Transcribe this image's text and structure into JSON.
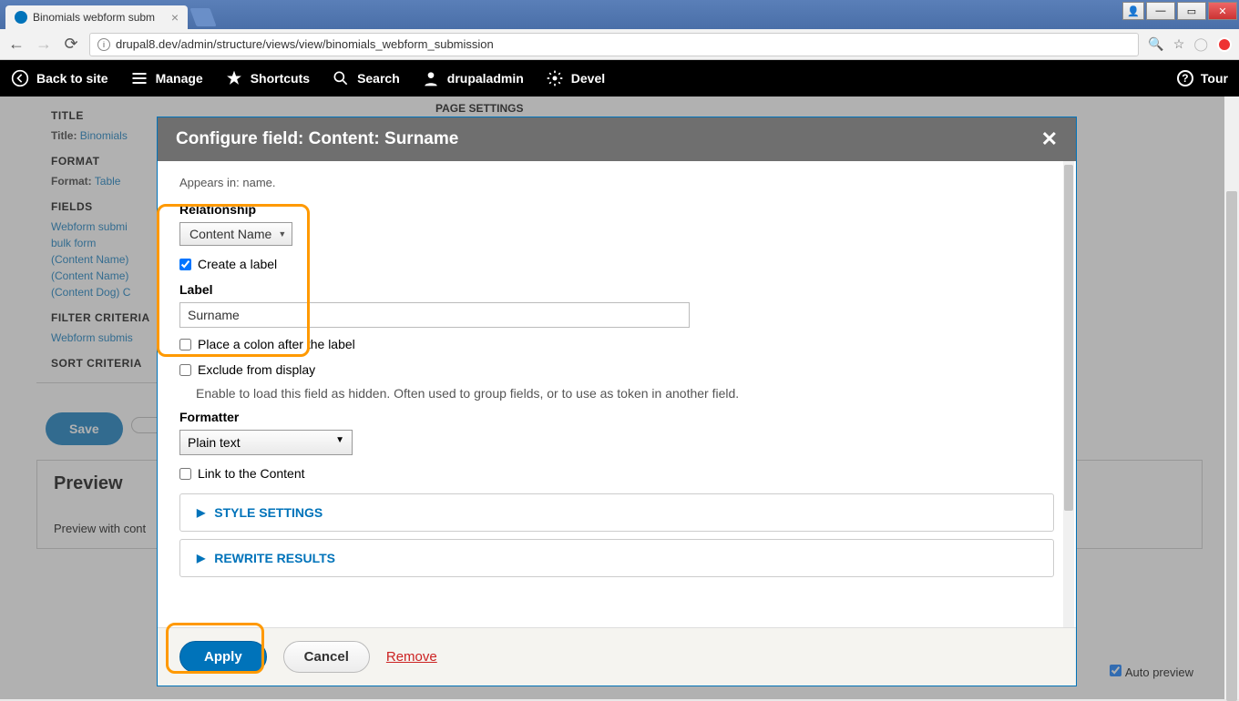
{
  "browser": {
    "tab_title": "Binomials webform subm",
    "url": "drupal8.dev/admin/structure/views/view/binomials_webform_submission"
  },
  "toolbar": {
    "back": "Back to site",
    "manage": "Manage",
    "shortcuts": "Shortcuts",
    "search": "Search",
    "user": "drupaladmin",
    "devel": "Devel",
    "tour": "Tour"
  },
  "views_ui": {
    "title_section": "TITLE",
    "title_label": "Title:",
    "title_value": "Binomials",
    "format_section": "FORMAT",
    "format_label": "Format:",
    "format_value": "Table",
    "fields_section": "FIELDS",
    "fields": [
      "Webform submi",
      "bulk form",
      "(Content Name)",
      "(Content Name)",
      "(Content Dog) C"
    ],
    "filter_section": "FILTER CRITERIA",
    "filter_item": "Webform submis",
    "sort_section": "SORT CRITERIA",
    "page_settings": "PAGE SETTINGS",
    "save_btn": "Save",
    "preview_h": "Preview",
    "preview_desc": "Preview with cont",
    "auto_preview": "Auto preview"
  },
  "modal": {
    "title": "Configure field: Content: Surname",
    "appears_in": "Appears in: name.",
    "relationship_label": "Relationship",
    "relationship_value": "Content Name",
    "create_label_chk": "Create a label",
    "label_label": "Label",
    "label_value": "Surname",
    "place_colon": "Place a colon after the label",
    "exclude": "Exclude from display",
    "exclude_help": "Enable to load this field as hidden. Often used to group fields, or to use as token in another field.",
    "formatter_label": "Formatter",
    "formatter_value": "Plain text",
    "link_content": "Link to the Content",
    "style_settings": "STYLE SETTINGS",
    "rewrite_results": "REWRITE RESULTS",
    "apply": "Apply",
    "cancel": "Cancel",
    "remove": "Remove"
  }
}
